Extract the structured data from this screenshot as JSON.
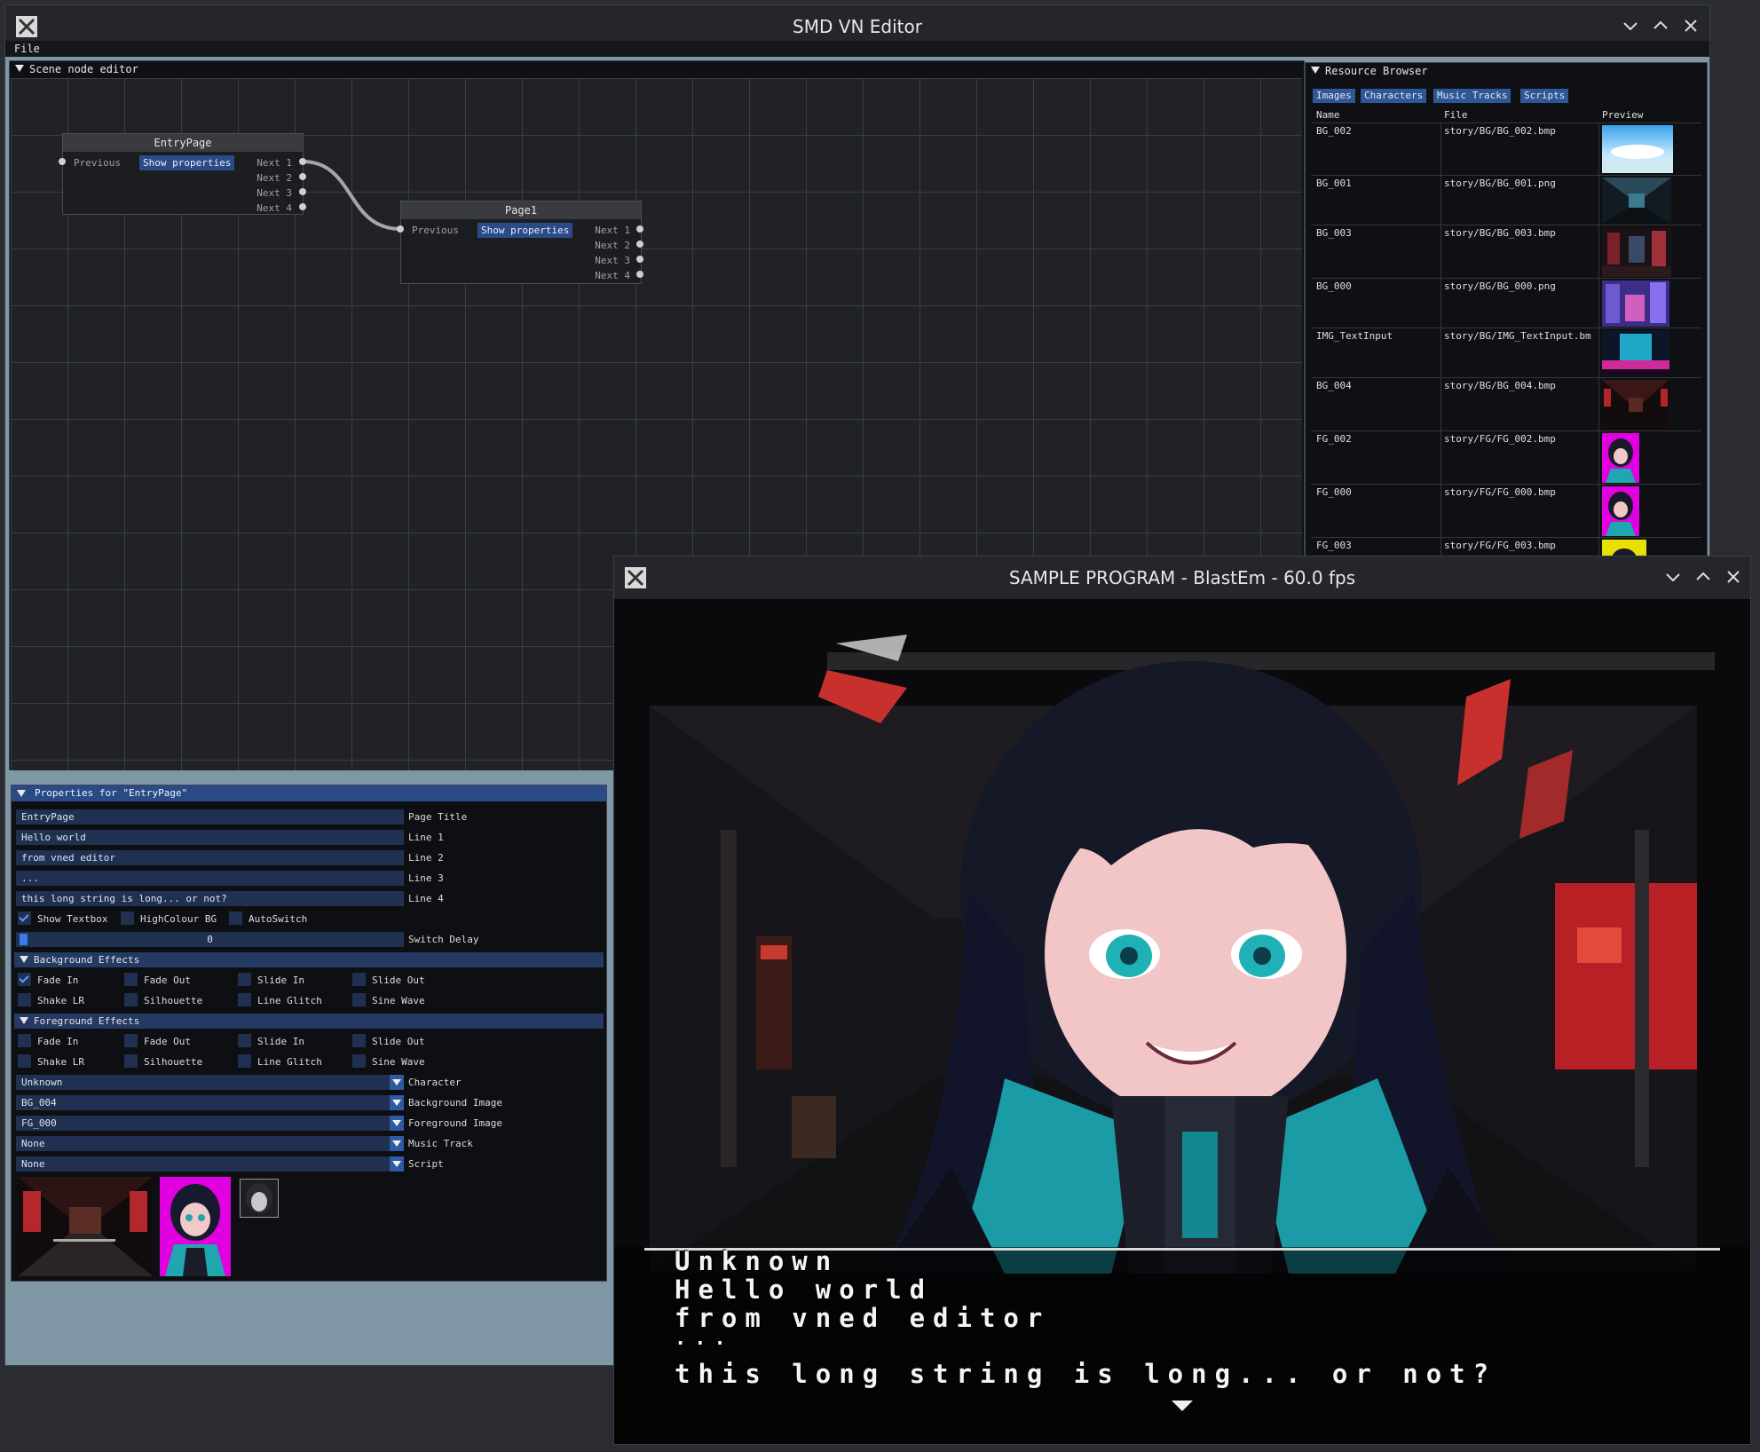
{
  "editor": {
    "title": "SMD VN Editor",
    "menu": [
      "File"
    ],
    "scene_editor": {
      "title": "Scene node editor",
      "nodes": [
        {
          "name": "EntryPage",
          "prev_label": "Previous",
          "button": "Show properties",
          "outputs": [
            "Next 1",
            "Next 2",
            "Next 3",
            "Next 4"
          ]
        },
        {
          "name": "Page1",
          "prev_label": "Previous",
          "button": "Show properties",
          "outputs": [
            "Next 1",
            "Next 2",
            "Next 3",
            "Next 4"
          ]
        }
      ]
    },
    "resource_browser": {
      "title": "Resource Browser",
      "tabs": [
        "Images",
        "Characters",
        "Music Tracks",
        "Scripts"
      ],
      "columns": [
        "Name",
        "File",
        "Preview"
      ],
      "rows": [
        {
          "name": "BG_002",
          "file": "story/BG/BG_002.bmp"
        },
        {
          "name": "BG_001",
          "file": "story/BG/BG_001.png"
        },
        {
          "name": "BG_003",
          "file": "story/BG/BG_003.bmp"
        },
        {
          "name": "BG_000",
          "file": "story/BG/BG_000.png"
        },
        {
          "name": "IMG_TextInput",
          "file": "story/BG/IMG_TextInput.bm"
        },
        {
          "name": "BG_004",
          "file": "story/BG/BG_004.bmp"
        },
        {
          "name": "FG_002",
          "file": "story/FG/FG_002.bmp"
        },
        {
          "name": "FG_000",
          "file": "story/FG/FG_000.bmp"
        },
        {
          "name": "FG_003",
          "file": "story/FG/FG_003.bmp"
        }
      ]
    },
    "properties": {
      "title": "Properties for \"EntryPage\"",
      "fields": [
        {
          "value": "EntryPage",
          "label": "Page Title"
        },
        {
          "value": "Hello world",
          "label": "Line 1"
        },
        {
          "value": "from vned editor",
          "label": "Line 2"
        },
        {
          "value": "...",
          "label": "Line 3"
        },
        {
          "value": "this long string is long... or not?",
          "label": "Line 4"
        }
      ],
      "toggles": [
        {
          "label": "Show Textbox",
          "checked": true
        },
        {
          "label": "HighColour BG",
          "checked": false
        },
        {
          "label": "AutoSwitch",
          "checked": false
        }
      ],
      "switch_delay": {
        "value": "0",
        "label": "Switch Delay"
      },
      "bg_effects": {
        "title": "Background Effects",
        "items": [
          {
            "label": "Fade In",
            "checked": true
          },
          {
            "label": "Fade Out",
            "checked": false
          },
          {
            "label": "Slide In",
            "checked": false
          },
          {
            "label": "Slide Out",
            "checked": false
          },
          {
            "label": "Shake LR",
            "checked": false
          },
          {
            "label": "Silhouette",
            "checked": false
          },
          {
            "label": "Line Glitch",
            "checked": false
          },
          {
            "label": "Sine Wave",
            "checked": false
          }
        ]
      },
      "fg_effects": {
        "title": "Foreground Effects",
        "items": [
          {
            "label": "Fade In",
            "checked": false
          },
          {
            "label": "Fade Out",
            "checked": false
          },
          {
            "label": "Slide In",
            "checked": false
          },
          {
            "label": "Slide Out",
            "checked": false
          },
          {
            "label": "Shake LR",
            "checked": false
          },
          {
            "label": "Silhouette",
            "checked": false
          },
          {
            "label": "Line Glitch",
            "checked": false
          },
          {
            "label": "Sine Wave",
            "checked": false
          }
        ]
      },
      "combos": [
        {
          "value": "Unknown",
          "label": "Character"
        },
        {
          "value": "BG_004",
          "label": "Background Image"
        },
        {
          "value": "FG_000",
          "label": "Foreground Image"
        },
        {
          "value": "None",
          "label": "Music Track"
        },
        {
          "value": "None",
          "label": "Script"
        }
      ]
    }
  },
  "emulator": {
    "title": "SAMPLE PROGRAM - BlastEm - 60.0 fps",
    "dialog": {
      "speaker": "Unknown",
      "lines": [
        "Hello world",
        "from vned editor",
        "...",
        "this long string is long... or not?"
      ]
    }
  },
  "colors": {
    "accent": "#2b4a86",
    "teal": "#1fa7b0",
    "magenta": "#e000e0"
  }
}
